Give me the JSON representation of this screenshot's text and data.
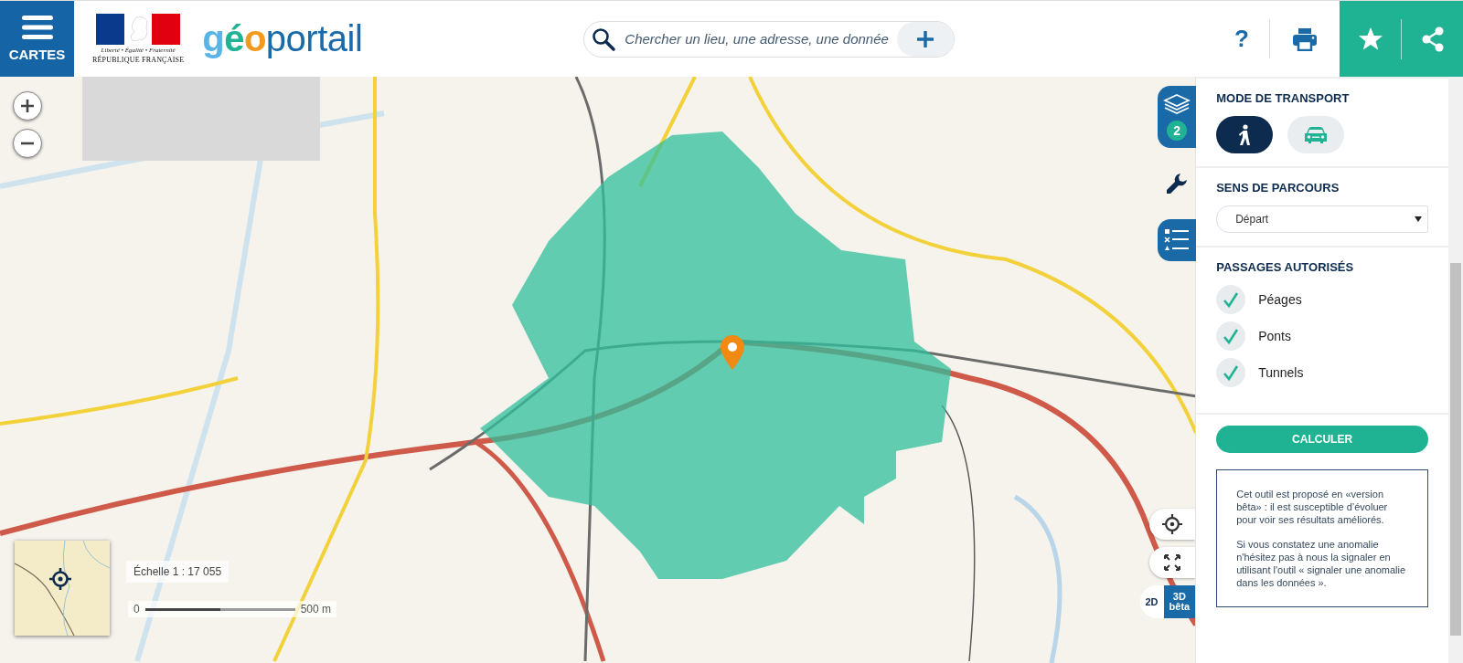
{
  "header": {
    "menu_label": "CARTES",
    "republic_motto": "Liberté • Égalité • Fraternité",
    "republic_name": "RÉPUBLIQUE FRANÇAISE",
    "brand": [
      {
        "text": "g",
        "color": "#5ab4e5"
      },
      {
        "text": "é",
        "color": "#1fb394"
      },
      {
        "text": "o",
        "color": "#f39a1e"
      },
      {
        "text": "portail",
        "color": "#1a6aa8"
      }
    ],
    "search": {
      "placeholder": "Chercher un lieu, une adresse, une donnée"
    },
    "help_label": "?"
  },
  "side_tabs": [
    {
      "kind": "layers",
      "badge": "2"
    },
    {
      "kind": "tools"
    },
    {
      "kind": "legend"
    }
  ],
  "map": {
    "scale_label": "Échelle 1 : 17 055",
    "scale_start": "0",
    "scale_end": "500 m",
    "view_modes": [
      {
        "label": "2D",
        "selected": false
      },
      {
        "label": "3D",
        "sublabel": "bêta",
        "selected": true
      }
    ]
  },
  "panel": {
    "transport": {
      "title": "MODE DE TRANSPORT",
      "modes": [
        {
          "kind": "walk",
          "selected": true
        },
        {
          "kind": "car",
          "selected": false
        }
      ]
    },
    "direction": {
      "title": "SENS DE PARCOURS",
      "value": "Départ"
    },
    "passages": {
      "title": "PASSAGES AUTORISÉS",
      "options": [
        {
          "label": "Péages",
          "checked": true
        },
        {
          "label": "Ponts",
          "checked": true
        },
        {
          "label": "Tunnels",
          "checked": true
        }
      ]
    },
    "submit": "CALCULER",
    "notice": [
      "Cet outil est proposé en «version bêta» : il est susceptible d’évoluer pour voir ses résultats améliorés.",
      "Si vous constatez une anomalie n'hésitez pas à nous la signaler en utilisant l'outil « signaler une anomalie dans les données »."
    ]
  }
}
